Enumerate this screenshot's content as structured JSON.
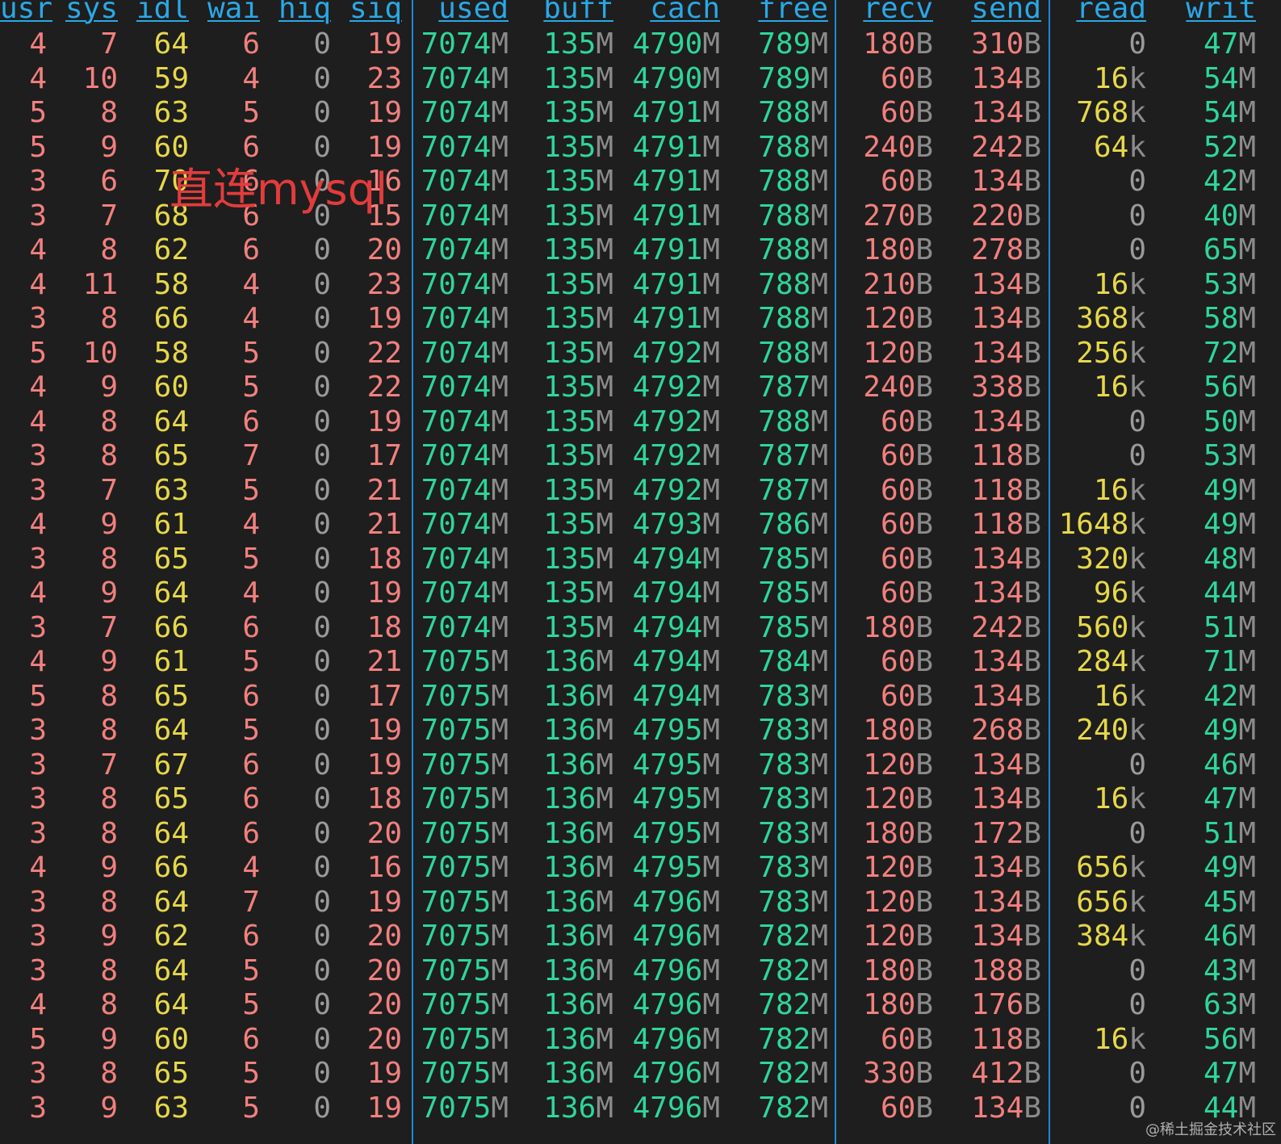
{
  "terminal": {
    "headers": [
      "usr",
      "sys",
      "idl",
      "wai",
      "hiq",
      "siq",
      "used",
      "buff",
      "cach",
      "free",
      "recv",
      "send",
      "read",
      "writ"
    ],
    "rows": [
      [
        "4",
        "7",
        "64",
        "6",
        "0",
        "19",
        "7074M",
        "135M",
        "4790M",
        "789M",
        "180B",
        "310B",
        "0",
        "47M"
      ],
      [
        "4",
        "10",
        "59",
        "4",
        "0",
        "23",
        "7074M",
        "135M",
        "4790M",
        "789M",
        "60B",
        "134B",
        "16k",
        "54M"
      ],
      [
        "5",
        "8",
        "63",
        "5",
        "0",
        "19",
        "7074M",
        "135M",
        "4791M",
        "788M",
        "60B",
        "134B",
        "768k",
        "54M"
      ],
      [
        "5",
        "9",
        "60",
        "6",
        "0",
        "19",
        "7074M",
        "135M",
        "4791M",
        "788M",
        "240B",
        "242B",
        "64k",
        "52M"
      ],
      [
        "3",
        "6",
        "70",
        "6",
        "0",
        "16",
        "7074M",
        "135M",
        "4791M",
        "788M",
        "60B",
        "134B",
        "0",
        "42M"
      ],
      [
        "3",
        "7",
        "68",
        "6",
        "0",
        "15",
        "7074M",
        "135M",
        "4791M",
        "788M",
        "270B",
        "220B",
        "0",
        "40M"
      ],
      [
        "4",
        "8",
        "62",
        "6",
        "0",
        "20",
        "7074M",
        "135M",
        "4791M",
        "788M",
        "180B",
        "278B",
        "0",
        "65M"
      ],
      [
        "4",
        "11",
        "58",
        "4",
        "0",
        "23",
        "7074M",
        "135M",
        "4791M",
        "788M",
        "210B",
        "134B",
        "16k",
        "53M"
      ],
      [
        "3",
        "8",
        "66",
        "4",
        "0",
        "19",
        "7074M",
        "135M",
        "4791M",
        "788M",
        "120B",
        "134B",
        "368k",
        "58M"
      ],
      [
        "5",
        "10",
        "58",
        "5",
        "0",
        "22",
        "7074M",
        "135M",
        "4792M",
        "788M",
        "120B",
        "134B",
        "256k",
        "72M"
      ],
      [
        "4",
        "9",
        "60",
        "5",
        "0",
        "22",
        "7074M",
        "135M",
        "4792M",
        "787M",
        "240B",
        "338B",
        "16k",
        "56M"
      ],
      [
        "4",
        "8",
        "64",
        "6",
        "0",
        "19",
        "7074M",
        "135M",
        "4792M",
        "788M",
        "60B",
        "134B",
        "0",
        "50M"
      ],
      [
        "3",
        "8",
        "65",
        "7",
        "0",
        "17",
        "7074M",
        "135M",
        "4792M",
        "787M",
        "60B",
        "118B",
        "0",
        "53M"
      ],
      [
        "3",
        "7",
        "63",
        "5",
        "0",
        "21",
        "7074M",
        "135M",
        "4792M",
        "787M",
        "60B",
        "118B",
        "16k",
        "49M"
      ],
      [
        "4",
        "9",
        "61",
        "4",
        "0",
        "21",
        "7074M",
        "135M",
        "4793M",
        "786M",
        "60B",
        "118B",
        "1648k",
        "49M"
      ],
      [
        "3",
        "8",
        "65",
        "5",
        "0",
        "18",
        "7074M",
        "135M",
        "4794M",
        "785M",
        "60B",
        "134B",
        "320k",
        "48M"
      ],
      [
        "4",
        "9",
        "64",
        "4",
        "0",
        "19",
        "7074M",
        "135M",
        "4794M",
        "785M",
        "60B",
        "134B",
        "96k",
        "44M"
      ],
      [
        "3",
        "7",
        "66",
        "6",
        "0",
        "18",
        "7074M",
        "135M",
        "4794M",
        "785M",
        "180B",
        "242B",
        "560k",
        "51M"
      ],
      [
        "4",
        "9",
        "61",
        "5",
        "0",
        "21",
        "7075M",
        "136M",
        "4794M",
        "784M",
        "60B",
        "134B",
        "284k",
        "71M"
      ],
      [
        "5",
        "8",
        "65",
        "6",
        "0",
        "17",
        "7075M",
        "136M",
        "4794M",
        "783M",
        "60B",
        "134B",
        "16k",
        "42M"
      ],
      [
        "3",
        "8",
        "64",
        "5",
        "0",
        "19",
        "7075M",
        "136M",
        "4795M",
        "783M",
        "180B",
        "268B",
        "240k",
        "49M"
      ],
      [
        "3",
        "7",
        "67",
        "6",
        "0",
        "19",
        "7075M",
        "136M",
        "4795M",
        "783M",
        "120B",
        "134B",
        "0",
        "46M"
      ],
      [
        "3",
        "8",
        "65",
        "6",
        "0",
        "18",
        "7075M",
        "136M",
        "4795M",
        "783M",
        "120B",
        "134B",
        "16k",
        "47M"
      ],
      [
        "3",
        "8",
        "64",
        "6",
        "0",
        "20",
        "7075M",
        "136M",
        "4795M",
        "783M",
        "180B",
        "172B",
        "0",
        "51M"
      ],
      [
        "4",
        "9",
        "66",
        "4",
        "0",
        "16",
        "7075M",
        "136M",
        "4795M",
        "783M",
        "120B",
        "134B",
        "656k",
        "49M"
      ],
      [
        "3",
        "8",
        "64",
        "7",
        "0",
        "19",
        "7075M",
        "136M",
        "4796M",
        "783M",
        "120B",
        "134B",
        "656k",
        "45M"
      ],
      [
        "3",
        "9",
        "62",
        "6",
        "0",
        "20",
        "7075M",
        "136M",
        "4796M",
        "782M",
        "120B",
        "134B",
        "384k",
        "46M"
      ],
      [
        "3",
        "8",
        "64",
        "5",
        "0",
        "20",
        "7075M",
        "136M",
        "4796M",
        "782M",
        "180B",
        "188B",
        "0",
        "43M"
      ],
      [
        "4",
        "8",
        "64",
        "5",
        "0",
        "20",
        "7075M",
        "136M",
        "4796M",
        "782M",
        "180B",
        "176B",
        "0",
        "63M"
      ],
      [
        "5",
        "9",
        "60",
        "6",
        "0",
        "20",
        "7075M",
        "136M",
        "4796M",
        "782M",
        "60B",
        "118B",
        "16k",
        "56M"
      ],
      [
        "3",
        "8",
        "65",
        "5",
        "0",
        "19",
        "7075M",
        "136M",
        "4796M",
        "782M",
        "330B",
        "412B",
        "0",
        "47M"
      ],
      [
        "3",
        "9",
        "63",
        "5",
        "0",
        "19",
        "7075M",
        "136M",
        "4796M",
        "782M",
        "60B",
        "134B",
        "0",
        "44M"
      ]
    ],
    "colors": {
      "background": "#1e1e1e",
      "header": "#2aa8e6",
      "separator": "#1e88d8",
      "red": "#f2807e",
      "yellow": "#e6d84a",
      "green": "#2ed69a",
      "gray": "#9a9a9a",
      "unit": "#8b8b8b"
    }
  },
  "annotation": "直连mysql",
  "watermark": "@稀土掘金技术社区"
}
